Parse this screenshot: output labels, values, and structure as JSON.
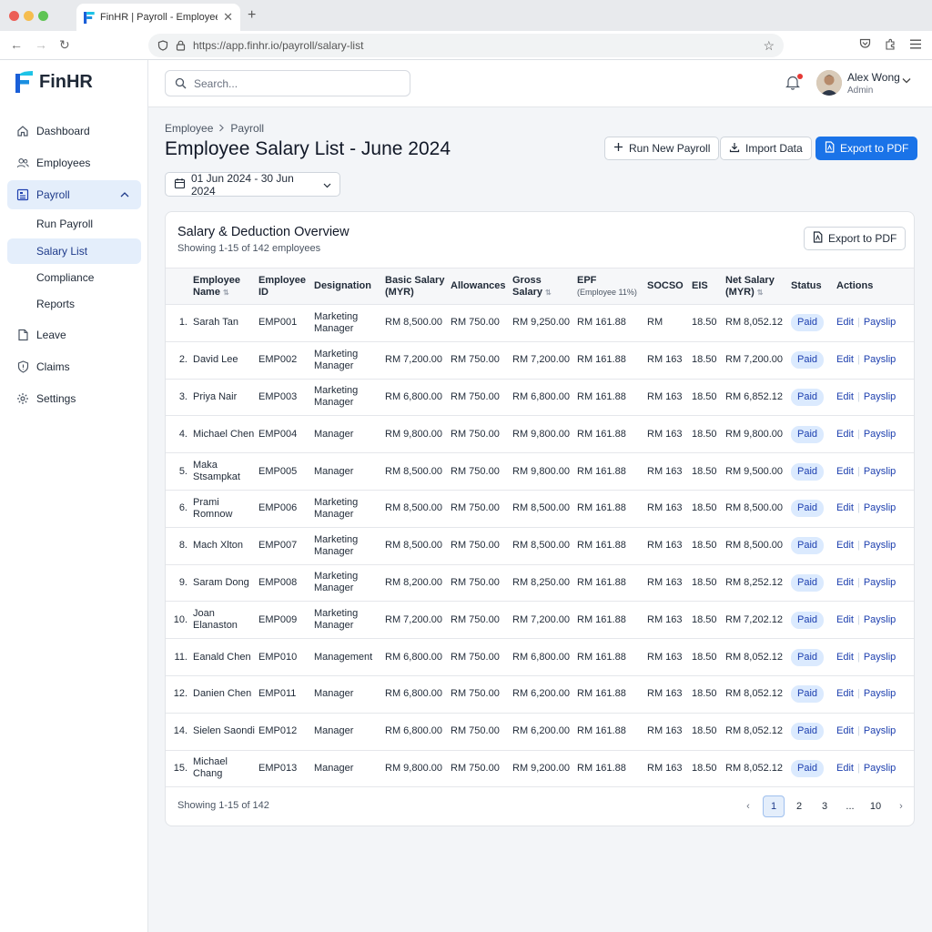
{
  "browser": {
    "tab_title": "FinHR | Payroll - Employee Salary",
    "url": "https://app.finhr.io/payroll/salary-list"
  },
  "brand": {
    "name": "FinHR",
    "colors": {
      "primary": "#1a73e8",
      "logo_cyan": "#1ec3e6",
      "logo_blue": "#1a5fd8"
    }
  },
  "sidebar": {
    "items": [
      {
        "label": "Dashboard",
        "icon": "home-icon"
      },
      {
        "label": "Employees",
        "icon": "users-icon"
      },
      {
        "label": "Payroll",
        "icon": "payroll-icon"
      },
      {
        "label": "Leave",
        "icon": "document-icon"
      },
      {
        "label": "Claims",
        "icon": "shield-icon"
      },
      {
        "label": "Settings",
        "icon": "gear-icon"
      }
    ],
    "payroll_sub": [
      {
        "label": "Run Payroll"
      },
      {
        "label": "Salary List"
      },
      {
        "label": "Compliance"
      },
      {
        "label": "Reports"
      }
    ]
  },
  "header": {
    "search_placeholder": "Search...",
    "user_name": "Alex Wong",
    "user_role": "Admin"
  },
  "page": {
    "breadcrumb": [
      "Employee",
      "Payroll"
    ],
    "title": "Employee Salary List - June 2024",
    "buttons": {
      "run": "Run New Payroll",
      "import": "Import Data",
      "export": "Export to PDF"
    },
    "date_range": "01 Jun 2024 - 30 Jun 2024"
  },
  "card": {
    "title": "Salary & Deduction Overview",
    "subtitle": "Showing 1-15 of 142 employees",
    "export_label": "Export to PDF",
    "columns": {
      "name": "Employee Name",
      "id": "Employee ID",
      "designation": "Designation",
      "basic": "Basic Salary (MYR)",
      "allowances": "Allowances",
      "gross": "Gross Salary",
      "epf": "EPF",
      "epf_sub": "(Employee 11%)",
      "socso": "SOCSO",
      "eis": "EIS",
      "net": "Net Salary (MYR)",
      "status": "Status",
      "actions": "Actions"
    },
    "rows": [
      {
        "no": "1.",
        "name": "Sarah Tan",
        "id": "EMP001",
        "designation": "Marketing Manager",
        "basic": "RM 8,500.00",
        "allowances": "RM 750.00",
        "gross": "RM 9,250.00",
        "epf": "RM 161.88",
        "socso": "RM",
        "eis": "18.50",
        "net": "RM 8,052.12",
        "status": "Paid"
      },
      {
        "no": "2.",
        "name": "David Lee",
        "id": "EMP002",
        "designation": "Marketing Manager",
        "basic": "RM 7,200.00",
        "allowances": "RM 750.00",
        "gross": "RM 7,200.00",
        "epf": "RM 161.88",
        "socso": "RM 163",
        "eis": "18.50",
        "net": "RM 7,200.00",
        "status": "Paid"
      },
      {
        "no": "3.",
        "name": "Priya Nair",
        "id": "EMP003",
        "designation": "Marketing Manager",
        "basic": "RM 6,800.00",
        "allowances": "RM 750.00",
        "gross": "RM 6,800.00",
        "epf": "RM 161.88",
        "socso": "RM 163",
        "eis": "18.50",
        "net": "RM 6,852.12",
        "status": "Paid"
      },
      {
        "no": "4.",
        "name": "Michael Chen",
        "id": "EMP004",
        "designation": "Manager",
        "basic": "RM 9,800.00",
        "allowances": "RM 750.00",
        "gross": "RM 9,800.00",
        "epf": "RM 161.88",
        "socso": "RM 163",
        "eis": "18.50",
        "net": "RM 9,800.00",
        "status": "Paid"
      },
      {
        "no": "5.",
        "name": "Maka Stsampkat",
        "id": "EMP005",
        "designation": "Manager",
        "basic": "RM 8,500.00",
        "allowances": "RM 750.00",
        "gross": "RM 9,800.00",
        "epf": "RM 161.88",
        "socso": "RM 163",
        "eis": "18.50",
        "net": "RM 9,500.00",
        "status": "Paid"
      },
      {
        "no": "6.",
        "name": "Prami Romnow",
        "id": "EMP006",
        "designation": "Marketing Manager",
        "basic": "RM 8,500.00",
        "allowances": "RM 750.00",
        "gross": "RM 8,500.00",
        "epf": "RM 161.88",
        "socso": "RM 163",
        "eis": "18.50",
        "net": "RM 8,500.00",
        "status": "Paid"
      },
      {
        "no": "8.",
        "name": "Mach Xlton",
        "id": "EMP007",
        "designation": "Marketing Manager",
        "basic": "RM 8,500.00",
        "allowances": "RM 750.00",
        "gross": "RM 8,500.00",
        "epf": "RM 161.88",
        "socso": "RM 163",
        "eis": "18.50",
        "net": "RM 8,500.00",
        "status": "Paid"
      },
      {
        "no": "9.",
        "name": "Saram Dong",
        "id": "EMP008",
        "designation": "Marketing Manager",
        "basic": "RM 8,200.00",
        "allowances": "RM 750.00",
        "gross": "RM 8,250.00",
        "epf": "RM 161.88",
        "socso": "RM 163",
        "eis": "18.50",
        "net": "RM 8,252.12",
        "status": "Paid"
      },
      {
        "no": "10.",
        "name": "Joan Elanaston",
        "id": "EMP009",
        "designation": "Marketing Manager",
        "basic": "RM 7,200.00",
        "allowances": "RM 750.00",
        "gross": "RM 7,200.00",
        "epf": "RM 161.88",
        "socso": "RM 163",
        "eis": "18.50",
        "net": "RM 7,202.12",
        "status": "Paid"
      },
      {
        "no": "11.",
        "name": "Eanald Chen",
        "id": "EMP010",
        "designation": "Management",
        "basic": "RM 6,800.00",
        "allowances": "RM 750.00",
        "gross": "RM 6,800.00",
        "epf": "RM 161.88",
        "socso": "RM 163",
        "eis": "18.50",
        "net": "RM 8,052.12",
        "status": "Paid"
      },
      {
        "no": "12.",
        "name": "Danien Chen",
        "id": "EMP011",
        "designation": "Manager",
        "basic": "RM 6,800.00",
        "allowances": "RM 750.00",
        "gross": "RM 6,200.00",
        "epf": "RM 161.88",
        "socso": "RM 163",
        "eis": "18.50",
        "net": "RM 8,052.12",
        "status": "Paid"
      },
      {
        "no": "14.",
        "name": "Sielen Saondi",
        "id": "EMP012",
        "designation": "Manager",
        "basic": "RM 6,800.00",
        "allowances": "RM 750.00",
        "gross": "RM 6,200.00",
        "epf": "RM 161.88",
        "socso": "RM 163",
        "eis": "18.50",
        "net": "RM 8,052.12",
        "status": "Paid"
      },
      {
        "no": "15.",
        "name": "Michael Chang",
        "id": "EMP013",
        "designation": "Manager",
        "basic": "RM 9,800.00",
        "allowances": "RM 750.00",
        "gross": "RM 9,200.00",
        "epf": "RM 161.88",
        "socso": "RM 163",
        "eis": "18.50",
        "net": "RM 8,052.12",
        "status": "Paid"
      }
    ],
    "action_edit": "Edit",
    "action_payslip": "Payslip",
    "footer_text": "Showing 1-15 of 142",
    "pages": [
      "1",
      "2",
      "3",
      "...",
      "10"
    ]
  }
}
